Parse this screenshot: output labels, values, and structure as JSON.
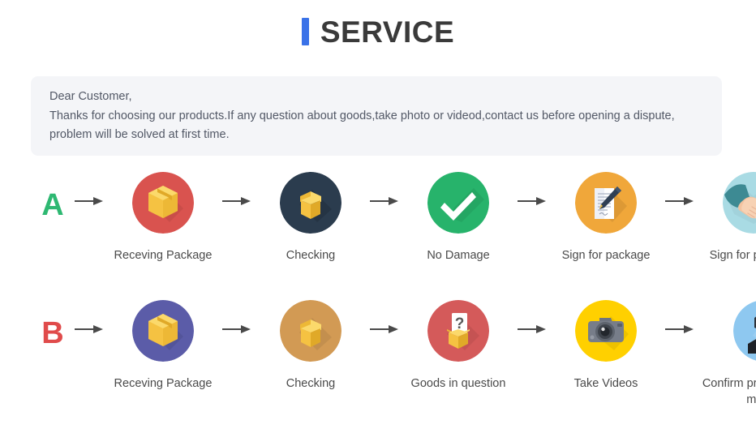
{
  "header": {
    "accent_color": "#3a72e8",
    "title": "SERVICE"
  },
  "notice": {
    "line1": "Dear Customer,",
    "line2": "Thanks for choosing our products.If any question about goods,take photo or videod,contact us before opening a dispute,",
    "line3": "problem will be solved at first time.",
    "background_color": "#f4f5f8"
  },
  "flows": [
    {
      "letter": "A",
      "letter_color": "#2eb872",
      "steps": [
        {
          "icon": "package-box-icon",
          "circle_color": "#d9534f",
          "label": "Receving Package"
        },
        {
          "icon": "open-box-icon",
          "circle_color": "#2b3c4e",
          "label": "Checking"
        },
        {
          "icon": "check-mark-icon",
          "circle_color": "#27b36b",
          "label": "No Damage"
        },
        {
          "icon": "document-pen-icon",
          "circle_color": "#f0a73a",
          "label": "Sign for package"
        },
        {
          "icon": "handshake-icon",
          "circle_color": "#a9dbe4",
          "label": "Sign for package"
        }
      ]
    },
    {
      "letter": "B",
      "letter_color": "#e04b4b",
      "steps": [
        {
          "icon": "package-box-icon",
          "circle_color": "#5b5ca8",
          "label": "Receving Package"
        },
        {
          "icon": "open-box-icon",
          "circle_color": "#d29a54",
          "label": "Checking"
        },
        {
          "icon": "question-box-icon",
          "circle_color": "#d45a5a",
          "label": "Goods in question"
        },
        {
          "icon": "camera-icon",
          "circle_color": "#ffd000",
          "label": "Take Videos"
        },
        {
          "icon": "support-agent-icon",
          "circle_color": "#8ec8f0",
          "label": "Confirm  problem,refund money"
        }
      ]
    }
  ],
  "arrow": {
    "icon": "arrow-right-icon",
    "color": "#4a4a4a"
  }
}
